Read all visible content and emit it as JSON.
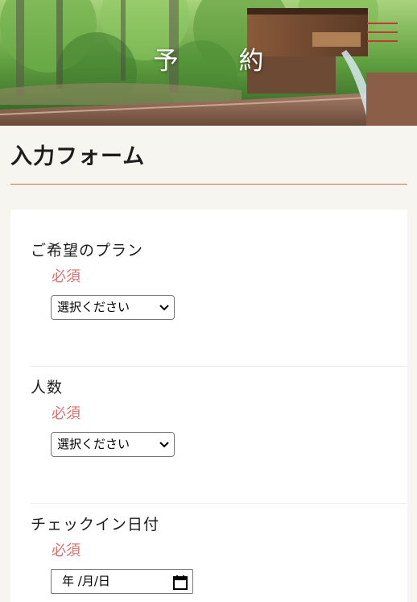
{
  "hero": {
    "title": "予　約",
    "menu_icon": "hamburger-menu-icon",
    "accent_color": "#c4392f"
  },
  "page": {
    "heading": "入力フォーム",
    "rule_color": "#d9694f"
  },
  "form": {
    "required_color": "#de7070",
    "fields": [
      {
        "label": "ご希望のプラン",
        "required": "必須",
        "control": "select",
        "value": "選択ください"
      },
      {
        "label": "人数",
        "required": "必須",
        "control": "select",
        "value": "選択ください"
      },
      {
        "label": "チェックイン日付",
        "required": "必須",
        "control": "date",
        "value": "年 /月/日"
      }
    ]
  }
}
